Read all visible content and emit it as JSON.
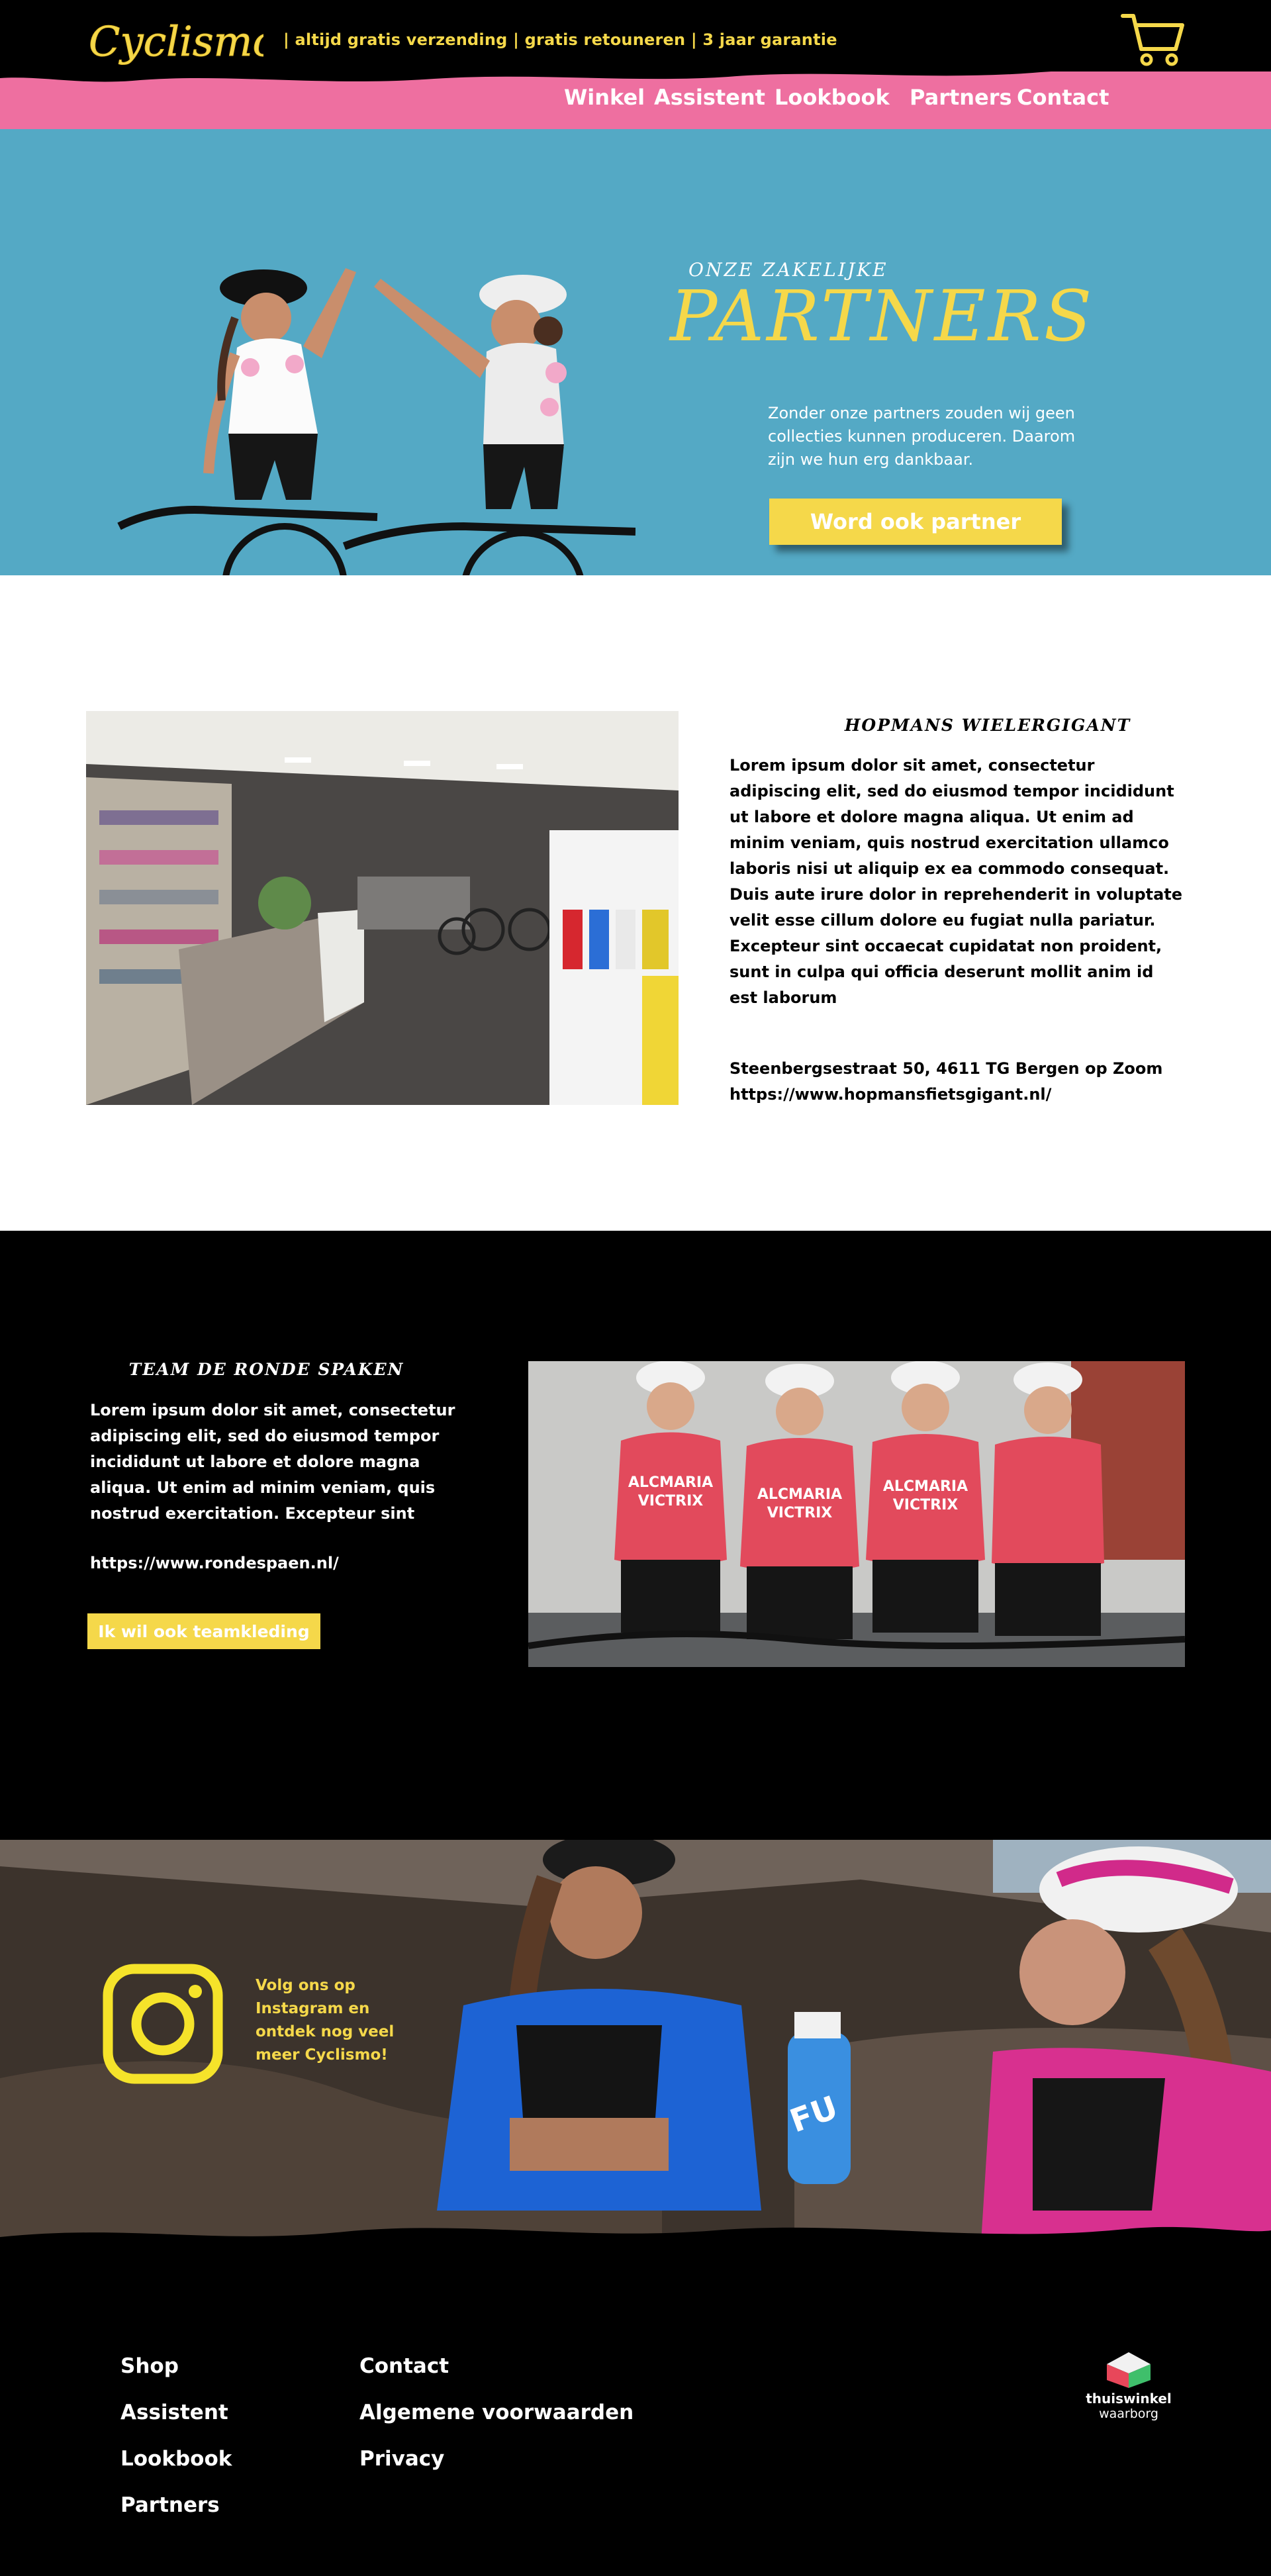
{
  "header": {
    "logo_text": "Cyclismo",
    "tagline": "| altijd gratis verzending | gratis retouneren | 3 jaar garantie",
    "cart_icon": "shopping-cart-icon",
    "colors": {
      "yellow": "#f5d84a",
      "pink": "#ee6fa0",
      "black": "#000000"
    }
  },
  "nav": {
    "items": [
      {
        "label": "Winkel"
      },
      {
        "label": "Assistent"
      },
      {
        "label": "Lookbook"
      },
      {
        "label": "Partners"
      },
      {
        "label": "Contact"
      }
    ]
  },
  "hero": {
    "subtitle": "ONZE ZAKELIJKE",
    "title": "PARTNERS",
    "text": "Zonder onze partners zouden wij geen collecties kunnen produceren. Daarom zijn we hun erg dankbaar.",
    "button": "Word ook partner",
    "background": "#54a9c5"
  },
  "partner1": {
    "title": "HOPMANS WIELERGIGANT",
    "body": "Lorem ipsum dolor sit amet, consectetur adipiscing elit, sed do eiusmod tempor incididunt ut labore et dolore magna aliqua. Ut enim ad minim veniam, quis nostrud exercitation ullamco laboris nisi ut aliquip ex ea commodo consequat. Duis aute irure dolor in reprehenderit in voluptate velit esse cillum dolore eu fugiat nulla pariatur. Excepteur sint occaecat cupidatat non proident, sunt in culpa qui officia deserunt mollit anim id est laborum",
    "address": "Steenbergsestraat 50, 4611 TG Bergen op Zoom",
    "url": "https://www.hopmansfietsgigant.nl/"
  },
  "partner2": {
    "title": "TEAM DE RONDE SPAKEN",
    "body": "Lorem ipsum dolor sit amet, consectetur adipiscing elit, sed do eiusmod tempor incididunt ut labore et dolore magna aliqua. Ut enim ad minim veniam, quis nostrud exercitation. Excepteur sint",
    "url": "https://www.rondespaen.nl/",
    "button": "Ik wil ook teamkleding",
    "jersey_text_1": "ALCMARIA",
    "jersey_text_2": "VICTRIX"
  },
  "instagram": {
    "icon": "instagram-icon",
    "text": "Volg ons op Instagram en ontdek nog veel meer Cyclismo!",
    "bottle_text": "FU"
  },
  "footer": {
    "col1": [
      {
        "label": "Shop"
      },
      {
        "label": "Assistent"
      },
      {
        "label": "Lookbook"
      },
      {
        "label": "Partners"
      }
    ],
    "col2": [
      {
        "label": "Contact"
      },
      {
        "label": "Algemene voorwaarden"
      },
      {
        "label": "Privacy"
      }
    ],
    "badge": {
      "line1": "thuiswinkel",
      "line2": "waarborg"
    }
  }
}
